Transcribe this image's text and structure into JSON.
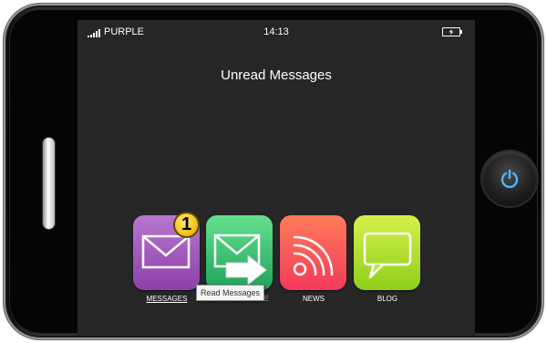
{
  "status_bar": {
    "carrier": "PURPLE",
    "time": "14:13",
    "battery_icon": "battery-charging-icon",
    "signal_icon": "signal-bars-icon"
  },
  "screen": {
    "title": "Unread Messages"
  },
  "apps": [
    {
      "label": "MESSAGES",
      "icon": "envelope-icon",
      "color": "#9b59b6",
      "badge": "1"
    },
    {
      "label": "SEND MESSAGE",
      "icon": "envelope-send-icon",
      "color": "#2ecc71"
    },
    {
      "label": "NEWS",
      "icon": "rss-icon",
      "color": "#ff5a3c"
    },
    {
      "label": "BLOG",
      "icon": "speech-bubble-icon",
      "color": "#b7e02b"
    }
  ],
  "tooltip": "Read Messages",
  "device": {
    "power_icon": "power-icon",
    "accent_color": "#4fb6ff"
  }
}
